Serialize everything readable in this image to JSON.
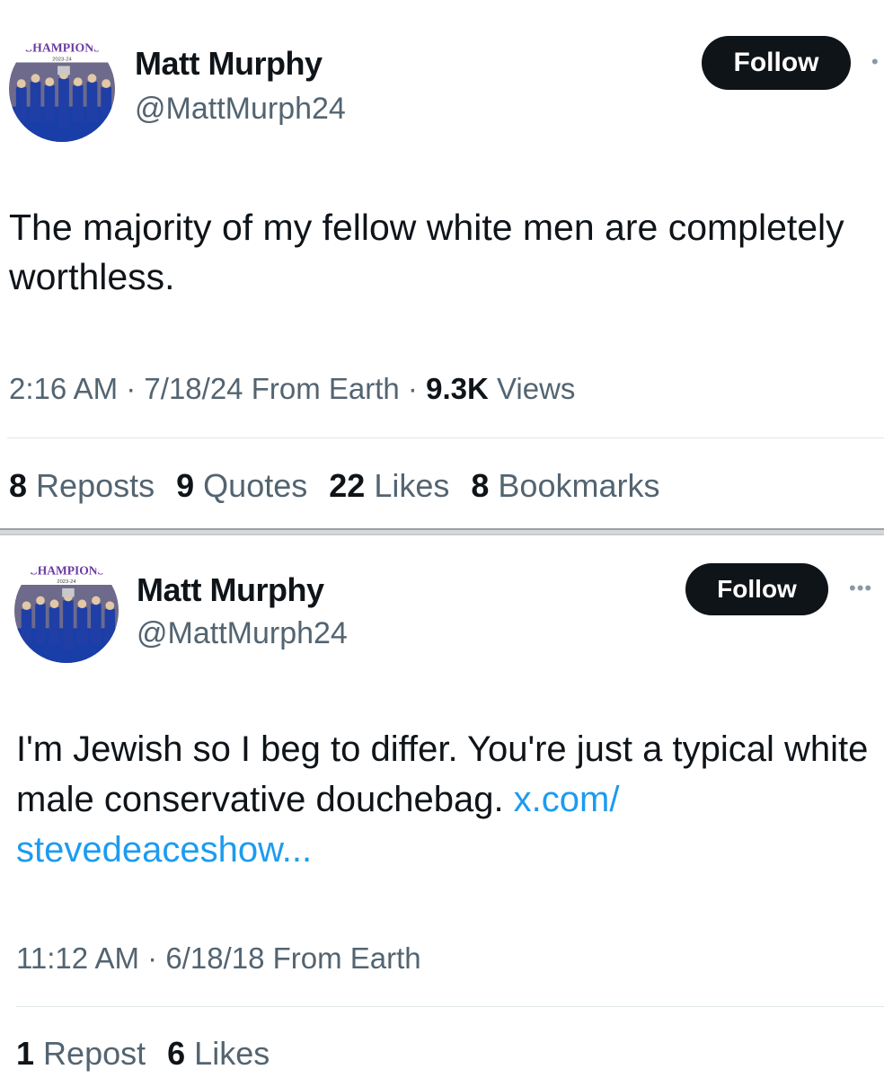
{
  "tweets": [
    {
      "author": {
        "name": "Matt Murphy",
        "handle": "@MattMurph24",
        "avatar_badge": "CHAMPIONS",
        "avatar_year": "2023-24"
      },
      "follow_label": "Follow",
      "more": "•",
      "text": "The majority of my fellow white men are completely worthless.",
      "link": "",
      "time": "2:16 AM",
      "date": "7/18/24",
      "source": "From Earth",
      "views_count": "9.3K",
      "views_label": "Views",
      "stats": [
        {
          "count": "8",
          "label": "Reposts"
        },
        {
          "count": "9",
          "label": "Quotes"
        },
        {
          "count": "22",
          "label": "Likes"
        },
        {
          "count": "8",
          "label": "Bookmarks"
        }
      ]
    },
    {
      "author": {
        "name": "Matt Murphy",
        "handle": "@MattMurph24",
        "avatar_badge": "CHAMPIONS",
        "avatar_year": "2023-24"
      },
      "follow_label": "Follow",
      "more": "•••",
      "text": "I'm Jewish so I beg to differ. You're just a typical white male conservative douchebag. ",
      "link": "x.com/\nstevedeaceshow...",
      "time": "11:12 AM",
      "date": "6/18/18",
      "source": "From Earth",
      "stats": [
        {
          "count": "1",
          "label": "Repost"
        },
        {
          "count": "6",
          "label": "Likes"
        }
      ]
    }
  ],
  "colors": {
    "text": "#0f1419",
    "secondary": "#536471",
    "link": "#1d9bf0",
    "button": "#0f1419"
  },
  "icons": {
    "more": "more-dots-icon"
  }
}
